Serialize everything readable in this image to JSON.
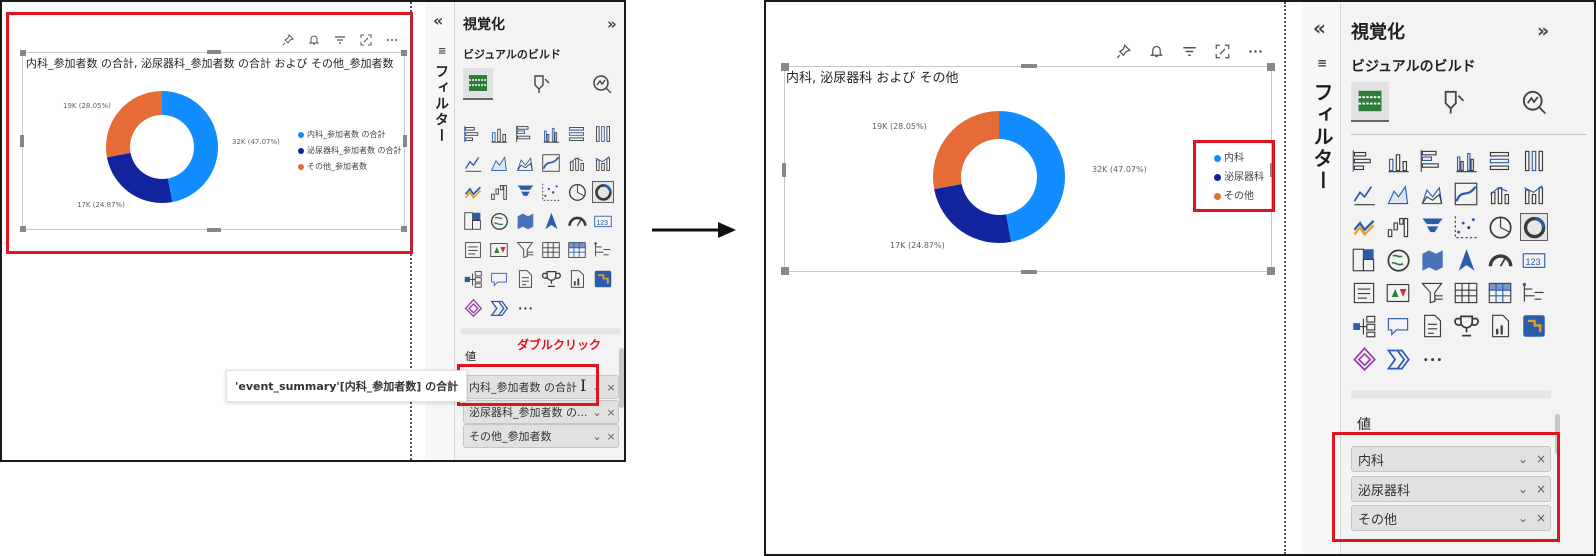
{
  "colors": {
    "blue": "#118dff",
    "navy": "#12239e",
    "orange": "#e66c37",
    "red_highlight": "#e0141e"
  },
  "before": {
    "visual": {
      "title": "内科_参加者数 の合計, 泌尿器科_参加者数 の合計 および その他_参加者数",
      "legend": [
        "内科_参加者数 の合計",
        "泌尿器科_参加者数 の合計",
        "その他_参加者数"
      ],
      "header_icons": [
        "pin-icon",
        "bell-icon",
        "filter-icon",
        "focus-mode-icon",
        "more-options-icon"
      ]
    },
    "tooltip": "'event_summary'[内科_参加者数] の合計",
    "pane": {
      "collapse_glyph": "«",
      "filters_label": "フィルター",
      "title": "視覚化",
      "expand_glyph": "»",
      "build_label": "ビジュアルのビルド",
      "values_label": "値",
      "double_click_label": "ダブルクリック",
      "fields": [
        {
          "label": "内科_参加者数 の合計"
        },
        {
          "label": "泌尿器科_参加者数 の..."
        },
        {
          "label": "その他_参加者数"
        }
      ],
      "more_glyph": "···"
    }
  },
  "after": {
    "visual": {
      "title": "内科, 泌尿器科 および その他",
      "legend": [
        "内科",
        "泌尿器科",
        "その他"
      ],
      "header_icons": [
        "pin-icon",
        "bell-icon",
        "filter-icon",
        "focus-mode-icon",
        "more-options-icon"
      ]
    },
    "pane": {
      "collapse_glyph": "«",
      "filters_label": "フィルター",
      "title": "視覚化",
      "expand_glyph": "»",
      "build_label": "ビジュアルのビルド",
      "values_label": "値",
      "fields": [
        {
          "label": "内科"
        },
        {
          "label": "泌尿器科"
        },
        {
          "label": "その他"
        }
      ],
      "more_glyph": "···"
    }
  },
  "chart_data": {
    "type": "pie",
    "hole": true,
    "categories": [
      "内科",
      "泌尿器科",
      "その他"
    ],
    "values": [
      32000,
      17000,
      19000
    ],
    "data_labels": [
      "32K (47.07%)",
      "17K (24.87%)",
      "19K (28.05%)"
    ],
    "colors": [
      "#118dff",
      "#12239e",
      "#e66c37"
    ],
    "legend_position": "right"
  },
  "chev": "⌄",
  "close": "×"
}
